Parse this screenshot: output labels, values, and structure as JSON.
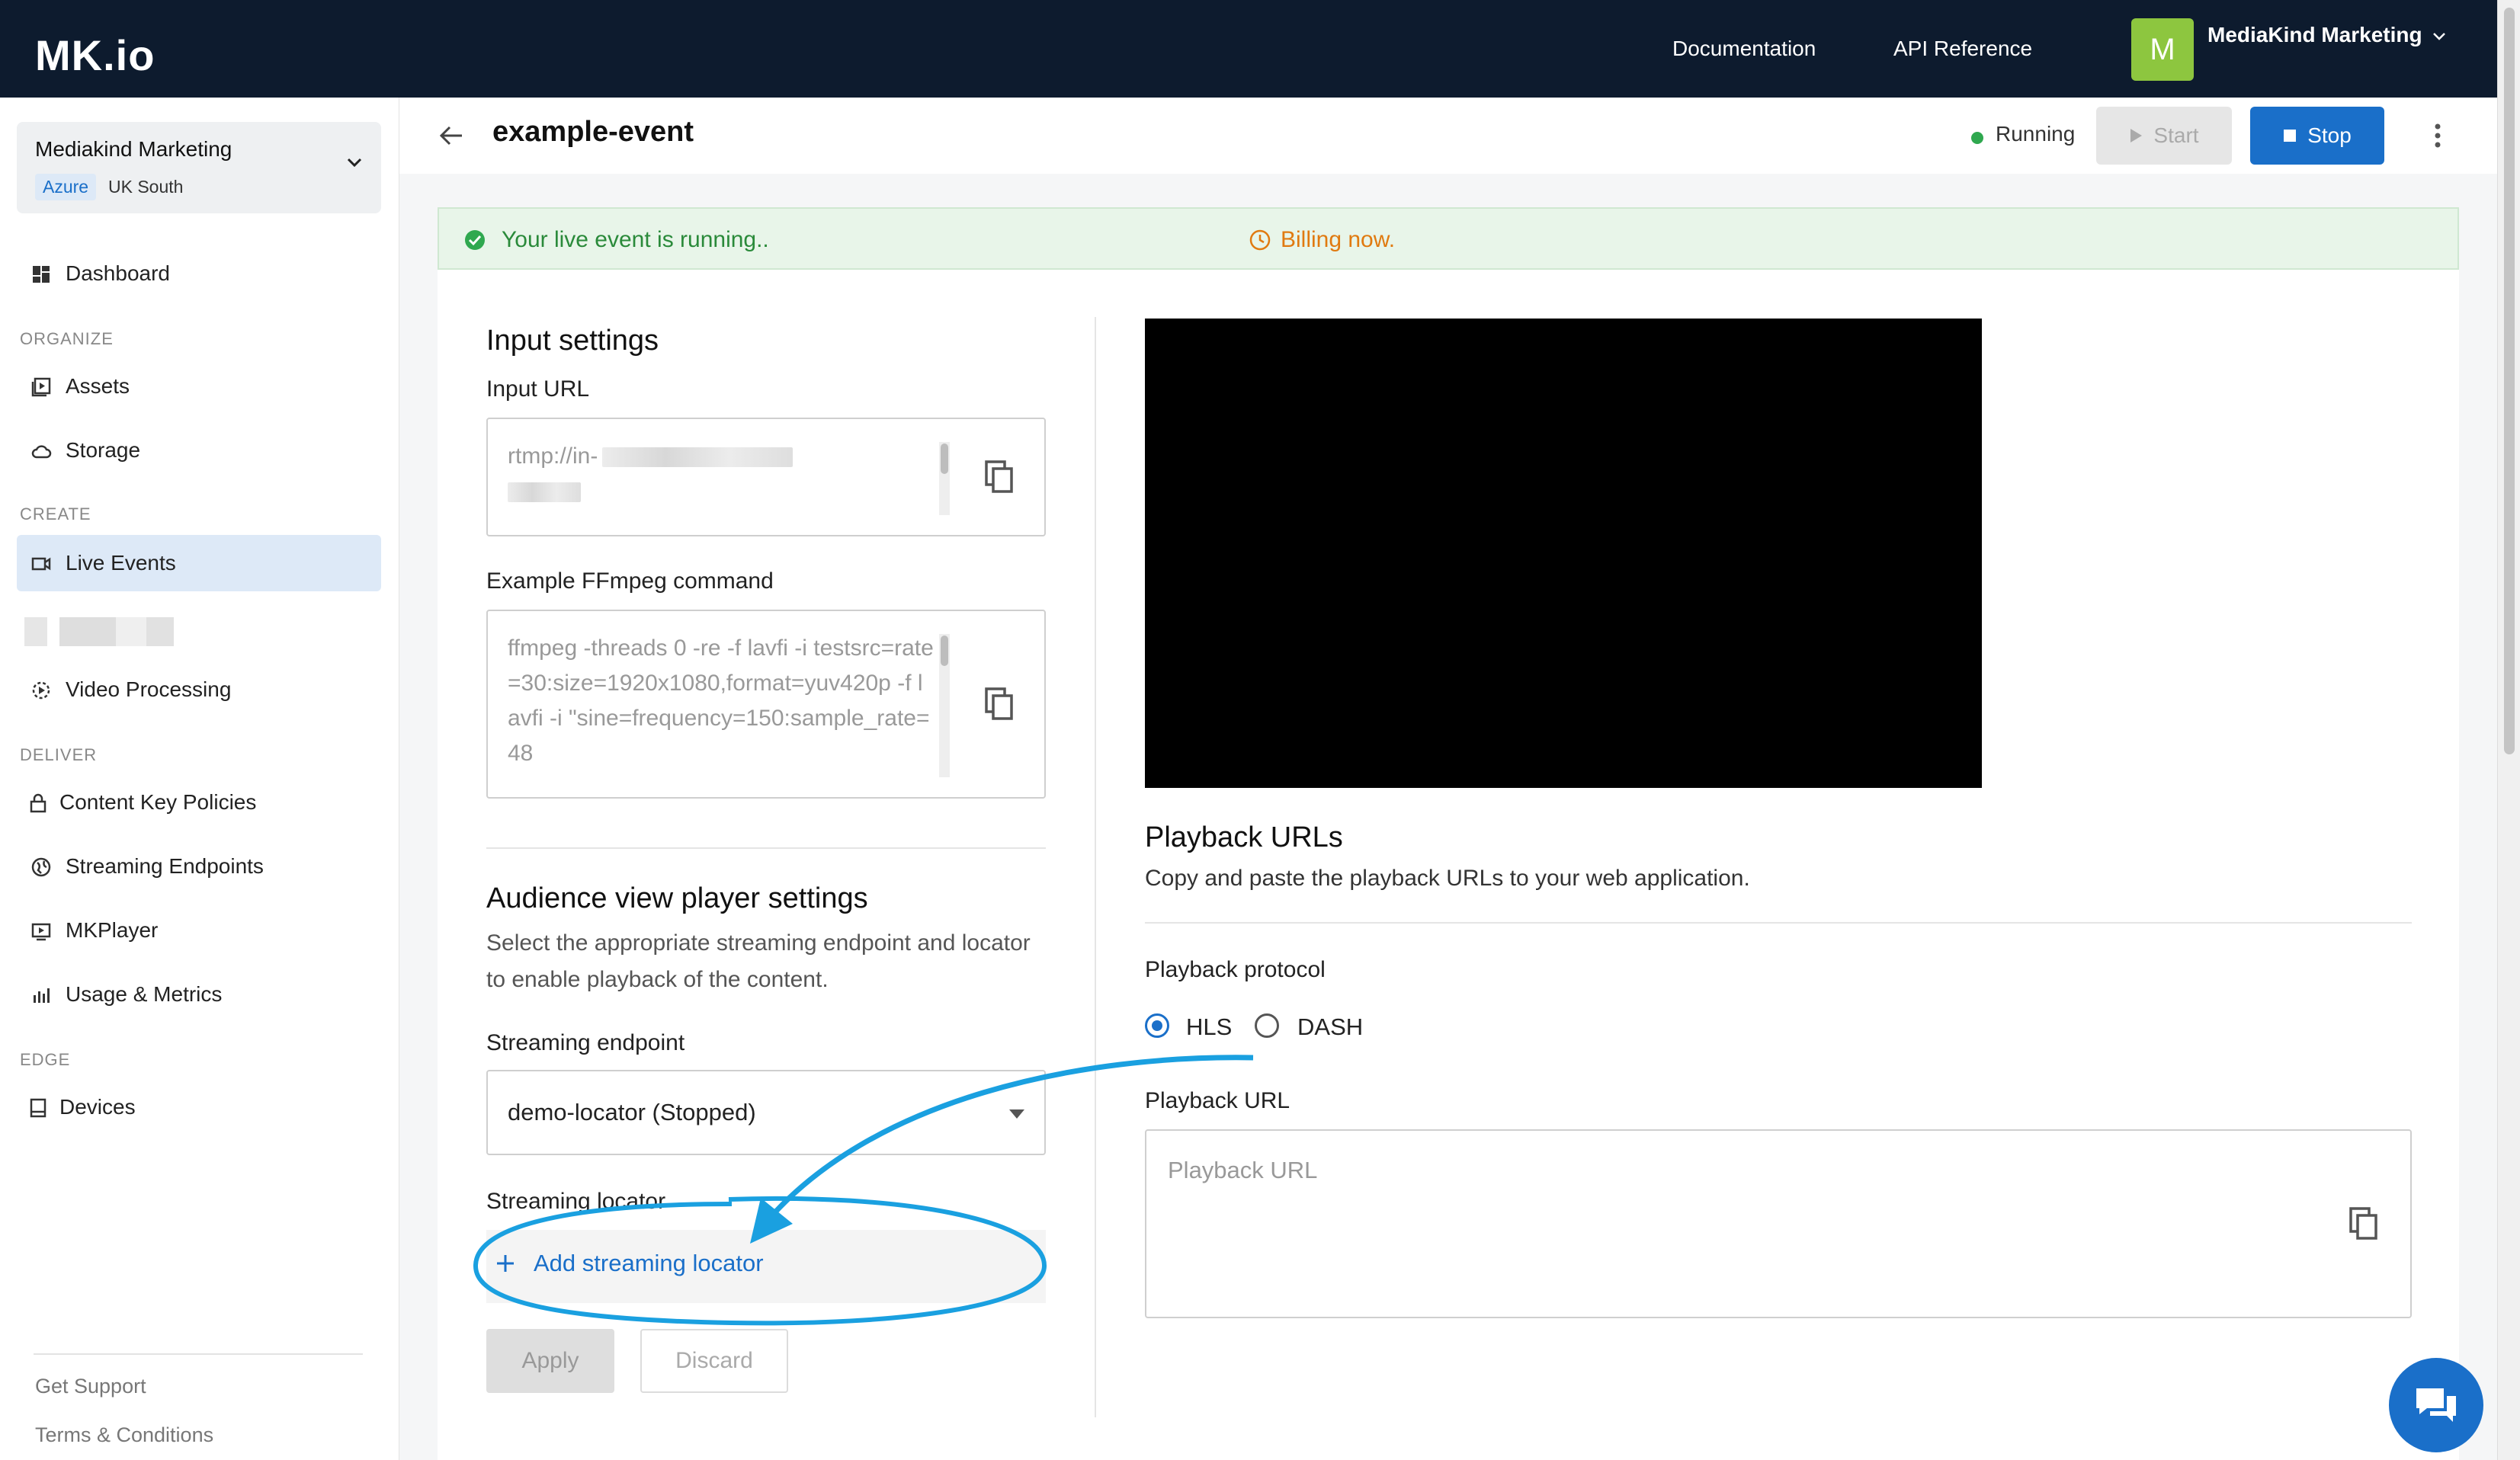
{
  "topbar": {
    "logo": "MK.io",
    "links": [
      "Documentation",
      "API Reference"
    ],
    "user_initial": "M",
    "user_name": "MediaKind Marketing"
  },
  "sidebar": {
    "org_name": "Mediakind Marketing",
    "org_badge": "Azure",
    "org_region": "UK South",
    "dashboard": "Dashboard",
    "sections": {
      "organize": "ORGANIZE",
      "create": "CREATE",
      "deliver": "DELIVER",
      "edge": "EDGE"
    },
    "items": {
      "assets": "Assets",
      "storage": "Storage",
      "live_events": "Live Events",
      "video_processing": "Video Processing",
      "content_key_policies": "Content Key Policies",
      "streaming_endpoints": "Streaming Endpoints",
      "mkplayer": "MKPlayer",
      "usage_metrics": "Usage & Metrics",
      "devices": "Devices"
    },
    "footer": {
      "support": "Get Support",
      "terms": "Terms & Conditions"
    }
  },
  "header": {
    "title": "example-event",
    "status": "Running",
    "start_label": "Start",
    "stop_label": "Stop",
    "status_color": "#2fa84f",
    "accent_color": "#1a6fc9"
  },
  "banner": {
    "message": "Your live event is running..",
    "billing": "Billing now."
  },
  "input_settings": {
    "title": "Input settings",
    "input_url_label": "Input URL",
    "input_url_value": "rtmp://in-",
    "ffmpeg_label": "Example FFmpeg command",
    "ffmpeg_value": "ffmpeg -threads 0 -re -f lavfi -i testsrc=rate=30:size=1920x1080,format=yuv420p -f lavfi -i \"sine=frequency=150:sample_rate=48"
  },
  "player_settings": {
    "title": "Audience view player settings",
    "description": "Select the appropriate streaming endpoint and locator to enable playback of the content.",
    "endpoint_label": "Streaming endpoint",
    "endpoint_value": "demo-locator (Stopped)",
    "locator_label": "Streaming locator",
    "add_locator": "Add streaming locator",
    "apply_label": "Apply",
    "discard_label": "Discard"
  },
  "playback": {
    "title": "Playback URLs",
    "description": "Copy and paste the playback URLs to your web application.",
    "protocol_label": "Playback protocol",
    "protocols": [
      "HLS",
      "DASH"
    ],
    "selected_protocol": "HLS",
    "url_label": "Playback URL",
    "url_placeholder": "Playback URL"
  },
  "annotation_color": "#1aa0e0"
}
